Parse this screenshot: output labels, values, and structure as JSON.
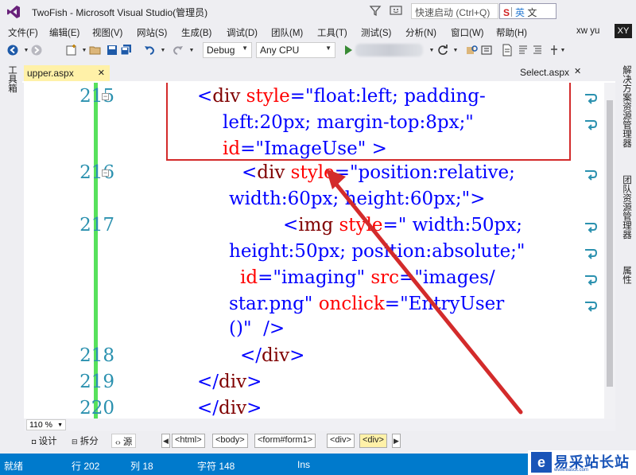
{
  "window": {
    "title": "TwoFish - Microsoft Visual Studio(管理员)",
    "quick_launch_placeholder": "快速启动 (Ctrl+Q)",
    "ime_mode": "S",
    "ime_lang": "英",
    "ime_extra": "文"
  },
  "menu": {
    "items": [
      "文件(F)",
      "编辑(E)",
      "视图(V)",
      "网站(S)",
      "生成(B)",
      "调试(D)",
      "团队(M)",
      "工具(T)",
      "测试(S)",
      "分析(N)",
      "窗口(W)",
      "帮助(H)"
    ],
    "user_name": "xw yu",
    "user_initials": "XY"
  },
  "toolbar": {
    "configuration": "Debug",
    "platform": "Any CPU"
  },
  "left_rail": {
    "toolbox_label": "工具箱"
  },
  "right_rail": {
    "solution_explorer_label": "解决方案资源管理器",
    "team_explorer_label": "团队资源管理器",
    "properties_label": "属性"
  },
  "tabs": {
    "active": "upper.aspx",
    "preview": "Select.aspx"
  },
  "editor": {
    "line_numbers": [
      "215",
      "216",
      "217",
      "218",
      "219",
      "220"
    ],
    "code": {
      "l215_a_open": "<",
      "l215_a_tag": "div",
      "l215_a_attr": " style",
      "l215_a_eq": "=",
      "l215_a_val": "\"float:left; padding-",
      "l215_b_val": "left:20px; margin-top:8px;\"",
      "l215_c_attr": "id",
      "l215_c_eq": "=",
      "l215_c_val": "\"ImageUse\"",
      "l215_c_close": " >",
      "l216_a_open": "<",
      "l216_a_tag": "div",
      "l216_a_attr": " style",
      "l216_a_eq": "=",
      "l216_a_val": "\"position:relative;",
      "l216_b_val": "width:60px; height:60px;\"",
      "l216_b_close": ">",
      "l217_a_open": "<",
      "l217_a_tag": "img",
      "l217_a_attr": " style",
      "l217_a_eq": "=",
      "l217_a_val": "\" width:50px;",
      "l217_b_val": "height:50px; position:absolute;\"",
      "l217_c_attr": "id",
      "l217_c_eq": "=",
      "l217_c_val": "\"imaging\"",
      "l217_c_attr2": " src",
      "l217_c_eq2": "=",
      "l217_c_val2": "\"images/",
      "l217_d_val": "star.png\"",
      "l217_d_attr": " onclick",
      "l217_d_eq": "=",
      "l217_d_val2": "\"EntryUser",
      "l217_e_val": "()\"",
      "l217_e_close": "  />",
      "l218_open": "</",
      "l218_tag": "div",
      "l218_close": ">",
      "l219_open": "</",
      "l219_tag": "div",
      "l219_close": ">",
      "l220_open": "</",
      "l220_tag": "div",
      "l220_close": ">"
    }
  },
  "zoom": {
    "level": "110 %"
  },
  "views": {
    "design": "设计",
    "split": "拆分",
    "source": "源"
  },
  "breadcrumbs": [
    "<html>",
    "<body>",
    "<form#form1>",
    "<div>",
    "<div>"
  ],
  "status": {
    "ready": "就绪",
    "line": "行 202",
    "col": "列 18",
    "char": "字符 148",
    "mode": "Ins"
  },
  "watermark": {
    "logo_glyph": "e",
    "text": "易采站长站",
    "sub": "www.easck.com"
  },
  "colors": {
    "status_bar": "#007acc",
    "change_bar": "#57e15c",
    "annotation": "#d32b2b",
    "active_tab": "#fff1a8"
  }
}
